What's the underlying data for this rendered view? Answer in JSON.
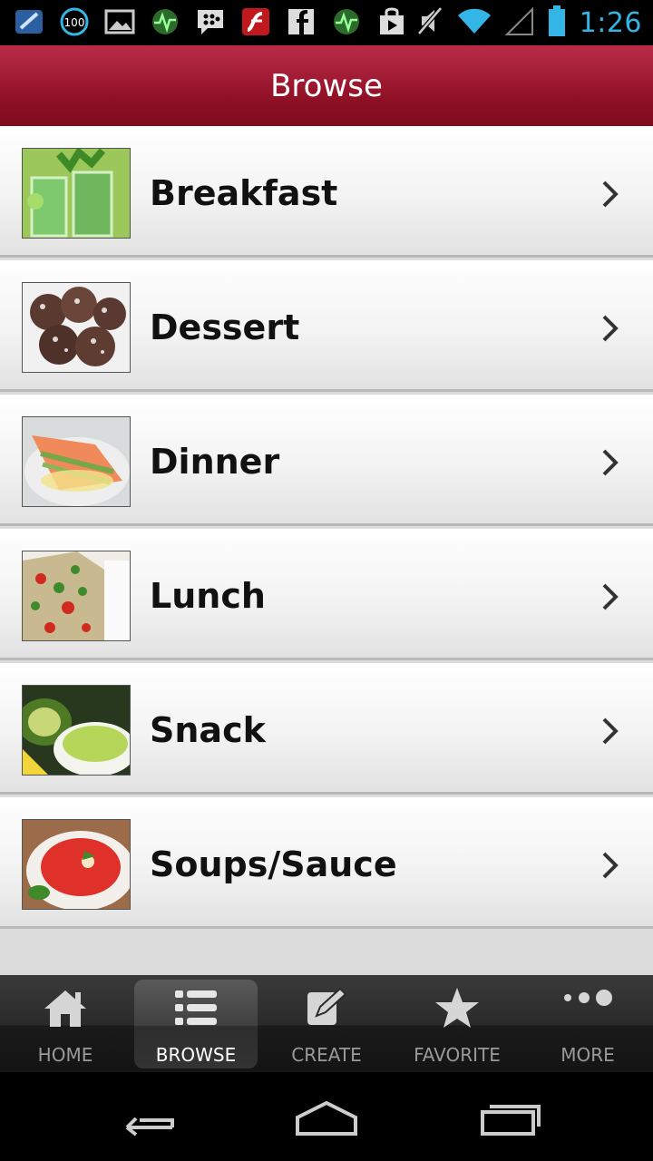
{
  "status_bar": {
    "time": "1:26",
    "notification_icons": [
      "android-app-icon",
      "battery-100-icon",
      "image-icon",
      "activity-icon",
      "blackberry-messenger-icon",
      "flash-player-icon",
      "facebook-icon",
      "activity-icon",
      "play-store-icon"
    ],
    "system_icons": [
      "mute-icon",
      "wifi-icon",
      "signal-icon",
      "battery-icon"
    ],
    "battery_badge": "100"
  },
  "header": {
    "title": "Browse"
  },
  "categories": [
    {
      "label": "Breakfast",
      "thumb": "green-smoothie"
    },
    {
      "label": "Dessert",
      "thumb": "coconut-truffles"
    },
    {
      "label": "Dinner",
      "thumb": "salmon-asparagus"
    },
    {
      "label": "Lunch",
      "thumb": "quinoa-salad"
    },
    {
      "label": "Snack",
      "thumb": "avocado-dip"
    },
    {
      "label": "Soups/Sauce",
      "thumb": "tomato-soup"
    }
  ],
  "tabs": [
    {
      "label": "HOME",
      "icon": "home-icon",
      "active": false
    },
    {
      "label": "BROWSE",
      "icon": "list-icon",
      "active": true
    },
    {
      "label": "CREATE",
      "icon": "edit-icon",
      "active": false
    },
    {
      "label": "FAVORITE",
      "icon": "star-icon",
      "active": false
    },
    {
      "label": "MORE",
      "icon": "more-dots-icon",
      "active": false
    }
  ],
  "nav": [
    "back-icon",
    "home-nav-icon",
    "recents-icon"
  ],
  "colors": {
    "header": "#9a1a30",
    "status_accent": "#33b5e5"
  }
}
